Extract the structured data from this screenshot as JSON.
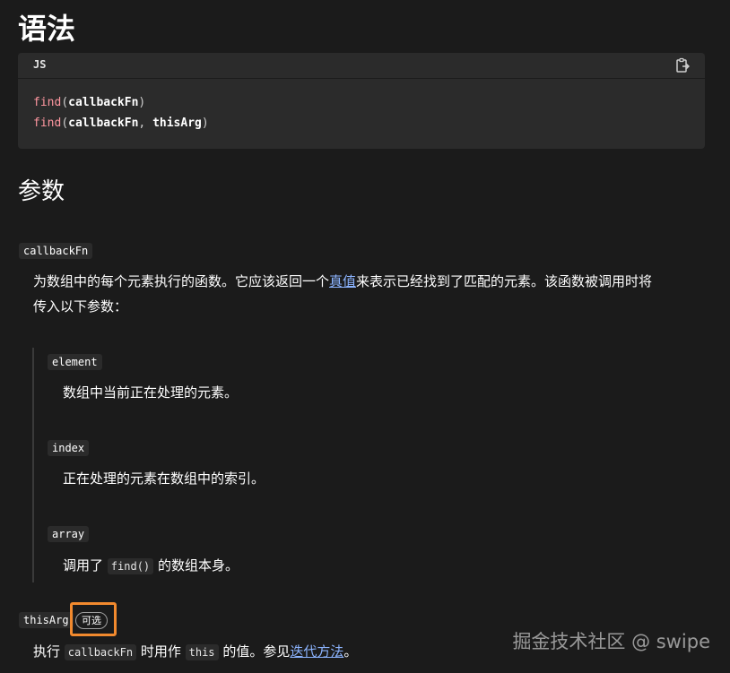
{
  "heading_syntax": "语法",
  "code_block": {
    "language": "JS",
    "copy_icon": "clipboard-copy-icon",
    "lines": [
      {
        "fn": "find",
        "open": "(",
        "args": "callbackFn",
        "close": ")"
      },
      {
        "fn": "find",
        "open": "(",
        "args": "callbackFn",
        "sep": ", ",
        "args2": "thisArg",
        "close": ")"
      }
    ]
  },
  "heading_params": "参数",
  "params": {
    "callbackFn": {
      "name": "callbackFn",
      "desc_before_link": "为数组中的每个元素执行的函数。它应该返回一个",
      "link": "真值",
      "desc_after_link": "来表示已经找到了匹配的元素。该函数被调用时将",
      "desc_line2": "传入以下参数："
    },
    "nested": {
      "element": {
        "name": "element",
        "desc": "数组中当前正在处理的元素。"
      },
      "index": {
        "name": "index",
        "desc": "正在处理的元素在数组中的索引。"
      },
      "array": {
        "name": "array",
        "desc_before": "调用了",
        "code": "find()",
        "desc_after": "的数组本身。"
      }
    },
    "thisArg": {
      "name": "thisArg",
      "optional_label": "可选",
      "desc_part1": "执行",
      "code1": "callbackFn",
      "desc_part2": "时用作",
      "code2": "this",
      "desc_part3": "的值。参见",
      "link": "迭代方法",
      "desc_part4": "。"
    }
  },
  "watermark": "掘金技术社区 @ swipe",
  "colors": {
    "background": "#1b1b1b",
    "code_bg": "#2b2b2b",
    "link": "#8cb4ff",
    "code_fn": "#ff97a0",
    "highlight": "#f28a2e"
  }
}
